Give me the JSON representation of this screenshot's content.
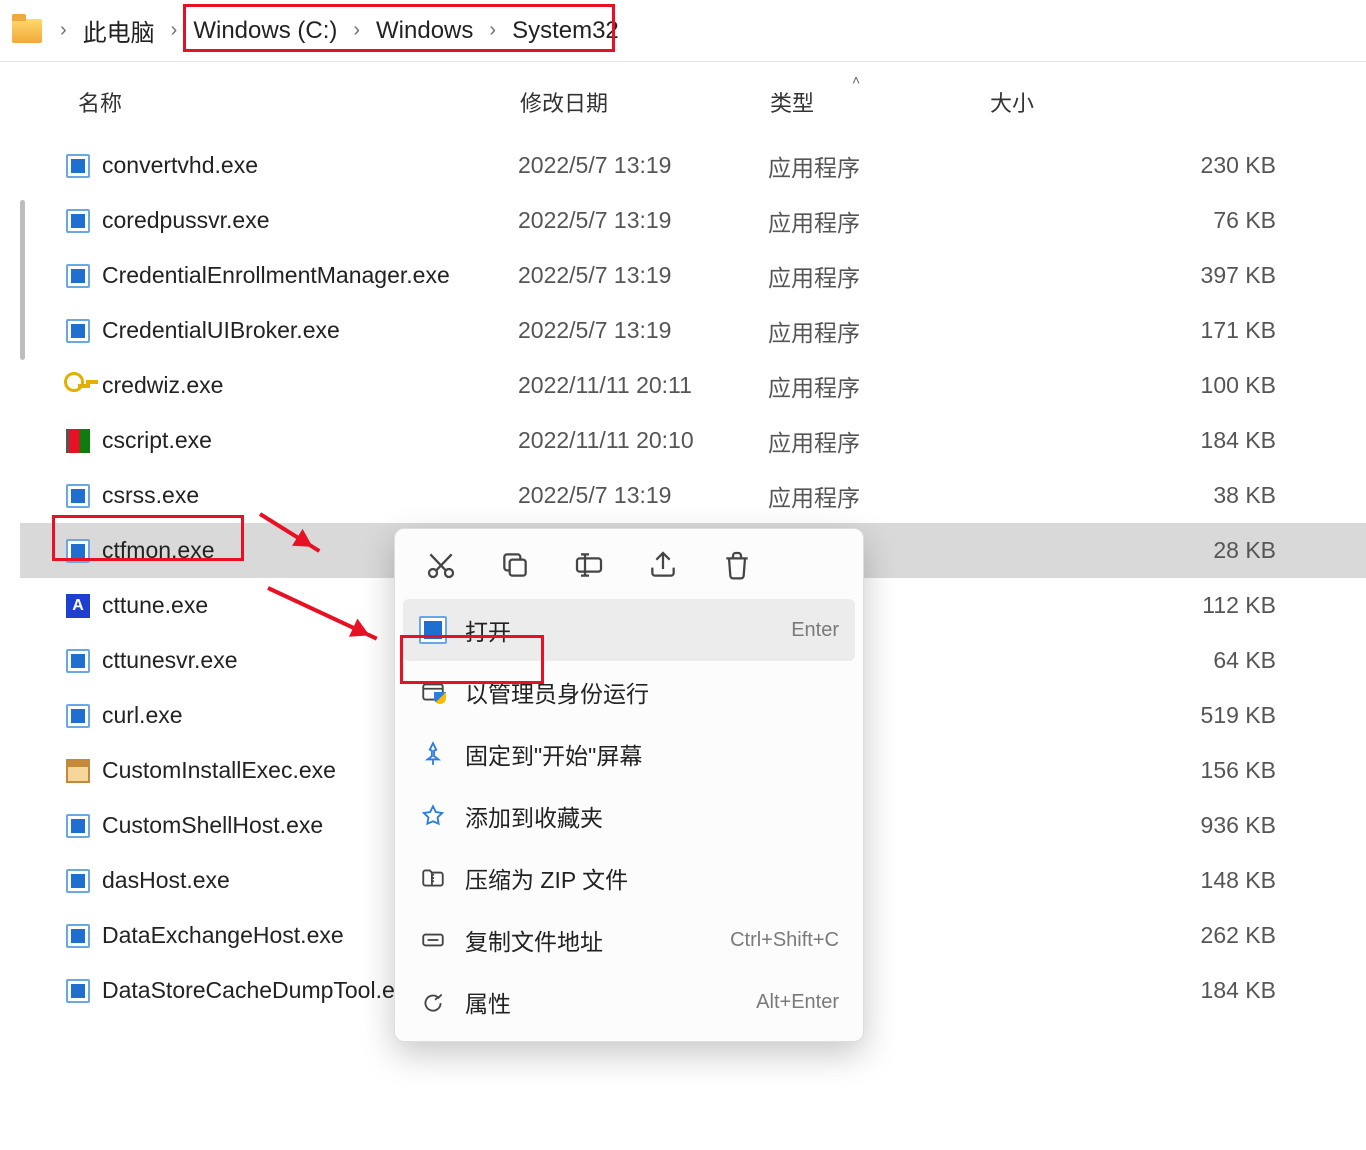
{
  "breadcrumb": {
    "items": [
      "此电脑",
      "Windows (C:)",
      "Windows",
      "System32"
    ]
  },
  "columns": {
    "name": "名称",
    "date": "修改日期",
    "type": "类型",
    "size": "大小"
  },
  "files": [
    {
      "icon": "exe",
      "name": "convertvhd.exe",
      "date": "2022/5/7 13:19",
      "type": "应用程序",
      "size": "230 KB",
      "sel": false
    },
    {
      "icon": "exe",
      "name": "coredpussvr.exe",
      "date": "2022/5/7 13:19",
      "type": "应用程序",
      "size": "76 KB",
      "sel": false
    },
    {
      "icon": "exe",
      "name": "CredentialEnrollmentManager.exe",
      "date": "2022/5/7 13:19",
      "type": "应用程序",
      "size": "397 KB",
      "sel": false
    },
    {
      "icon": "exe",
      "name": "CredentialUIBroker.exe",
      "date": "2022/5/7 13:19",
      "type": "应用程序",
      "size": "171 KB",
      "sel": false
    },
    {
      "icon": "key",
      "name": "credwiz.exe",
      "date": "2022/11/11 20:11",
      "type": "应用程序",
      "size": "100 KB",
      "sel": false
    },
    {
      "icon": "flag",
      "name": "cscript.exe",
      "date": "2022/11/11 20:10",
      "type": "应用程序",
      "size": "184 KB",
      "sel": false
    },
    {
      "icon": "exe",
      "name": "csrss.exe",
      "date": "2022/5/7 13:19",
      "type": "应用程序",
      "size": "38 KB",
      "sel": false
    },
    {
      "icon": "exe",
      "name": "ctfmon.exe",
      "date": "",
      "type": "",
      "size": "28 KB",
      "sel": true
    },
    {
      "icon": "A",
      "name": "cttune.exe",
      "date": "",
      "type": "",
      "size": "112 KB",
      "sel": false
    },
    {
      "icon": "exe",
      "name": "cttunesvr.exe",
      "date": "",
      "type": "",
      "size": "64 KB",
      "sel": false
    },
    {
      "icon": "exe",
      "name": "curl.exe",
      "date": "",
      "type": "",
      "size": "519 KB",
      "sel": false
    },
    {
      "icon": "box",
      "name": "CustomInstallExec.exe",
      "date": "",
      "type": "",
      "size": "156 KB",
      "sel": false
    },
    {
      "icon": "exe",
      "name": "CustomShellHost.exe",
      "date": "",
      "type": "",
      "size": "936 KB",
      "sel": false
    },
    {
      "icon": "exe",
      "name": "dasHost.exe",
      "date": "",
      "type": "",
      "size": "148 KB",
      "sel": false
    },
    {
      "icon": "exe",
      "name": "DataExchangeHost.exe",
      "date": "",
      "type": "",
      "size": "262 KB",
      "sel": false
    },
    {
      "icon": "exe",
      "name": "DataStoreCacheDumpTool.e",
      "date": "",
      "type": "",
      "size": "184 KB",
      "sel": false
    }
  ],
  "menu": {
    "toolbar": [
      "cut",
      "copy",
      "rename",
      "share",
      "delete"
    ],
    "items": [
      {
        "icon": "app",
        "label": "打开",
        "shortcut": "Enter",
        "sel": true
      },
      {
        "icon": "admin",
        "label": "以管理员身份运行",
        "shortcut": "",
        "sel": false
      },
      {
        "icon": "pin",
        "label": "固定到\"开始\"屏幕",
        "shortcut": "",
        "sel": false
      },
      {
        "icon": "star",
        "label": "添加到收藏夹",
        "shortcut": "",
        "sel": false
      },
      {
        "icon": "zip",
        "label": "压缩为 ZIP 文件",
        "shortcut": "",
        "sel": false
      },
      {
        "icon": "path",
        "label": "复制文件地址",
        "shortcut": "Ctrl+Shift+C",
        "sel": false
      },
      {
        "icon": "props",
        "label": "属性",
        "shortcut": "Alt+Enter",
        "sel": false
      }
    ]
  }
}
